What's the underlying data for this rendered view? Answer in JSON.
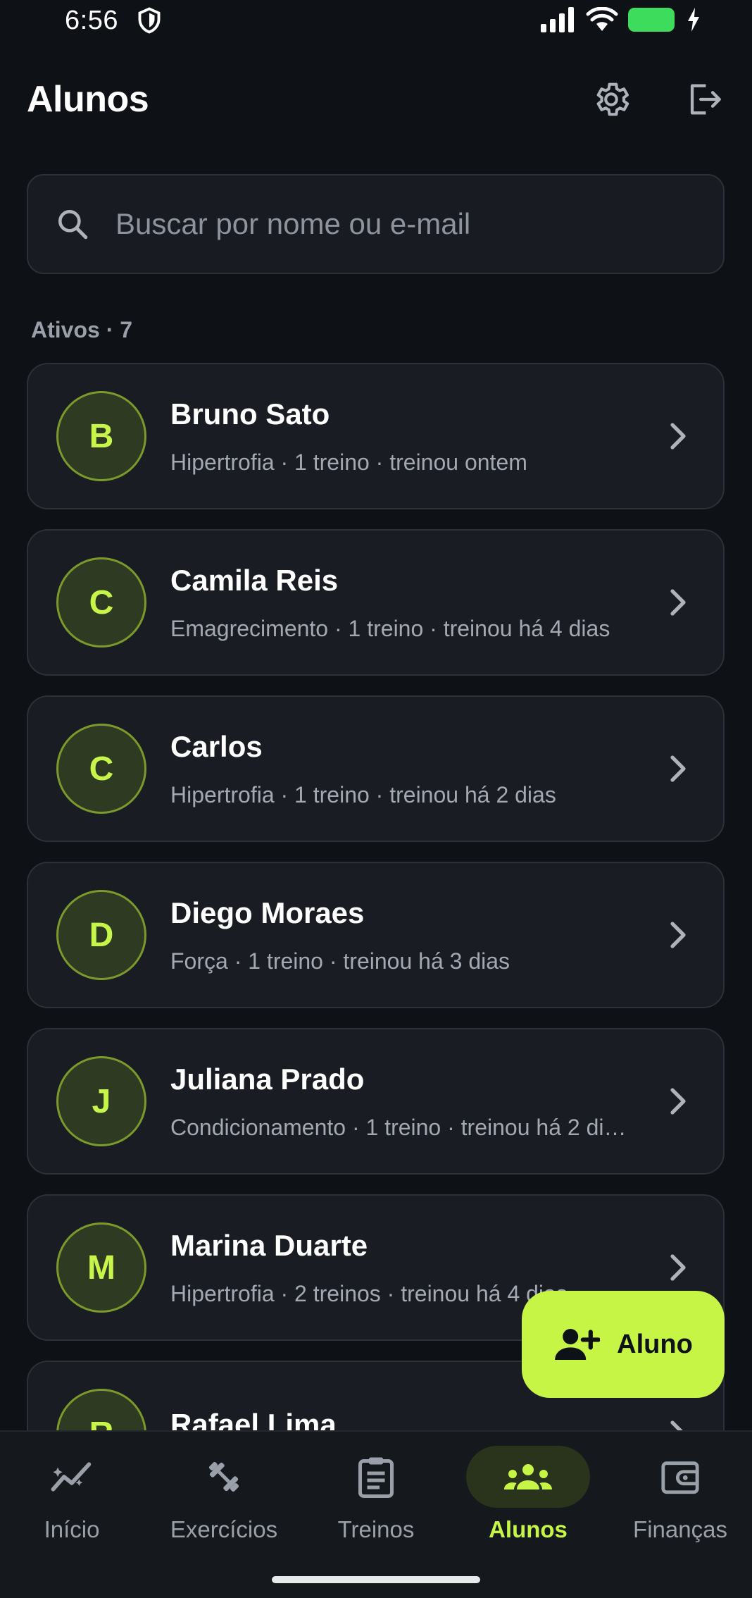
{
  "status_bar": {
    "time": "6:56"
  },
  "header": {
    "title": "Alunos"
  },
  "search": {
    "placeholder": "Buscar por nome ou e-mail"
  },
  "section": {
    "label": "Ativos · 7"
  },
  "students": [
    {
      "initial": "B",
      "name": "Bruno Sato",
      "meta": "Hipertrofia · 1 treino · treinou ontem"
    },
    {
      "initial": "C",
      "name": "Camila Reis",
      "meta": "Emagrecimento · 1 treino · treinou há 4 dias"
    },
    {
      "initial": "C",
      "name": "Carlos",
      "meta": "Hipertrofia · 1 treino · treinou há 2 dias"
    },
    {
      "initial": "D",
      "name": "Diego Moraes",
      "meta": "Força · 1 treino · treinou há 3 dias"
    },
    {
      "initial": "J",
      "name": "Juliana Prado",
      "meta": "Condicionamento · 1 treino · treinou há 2 di…"
    },
    {
      "initial": "M",
      "name": "Marina Duarte",
      "meta": "Hipertrofia · 2 treinos · treinou há 4 dias"
    },
    {
      "initial": "R",
      "name": "Rafael Lima",
      "meta": ""
    }
  ],
  "fab": {
    "label": "Aluno",
    "icon": "person-add-icon"
  },
  "nav": [
    {
      "label": "Início",
      "icon": "chart-line-icon"
    },
    {
      "label": "Exercícios",
      "icon": "dumbbell-icon"
    },
    {
      "label": "Treinos",
      "icon": "clipboard-icon"
    },
    {
      "label": "Alunos",
      "icon": "people-icon",
      "active": true
    },
    {
      "label": "Finanças",
      "icon": "wallet-icon"
    }
  ],
  "colors": {
    "accent": "#c6f545",
    "background": "#0e1116",
    "card": "#191c22"
  }
}
